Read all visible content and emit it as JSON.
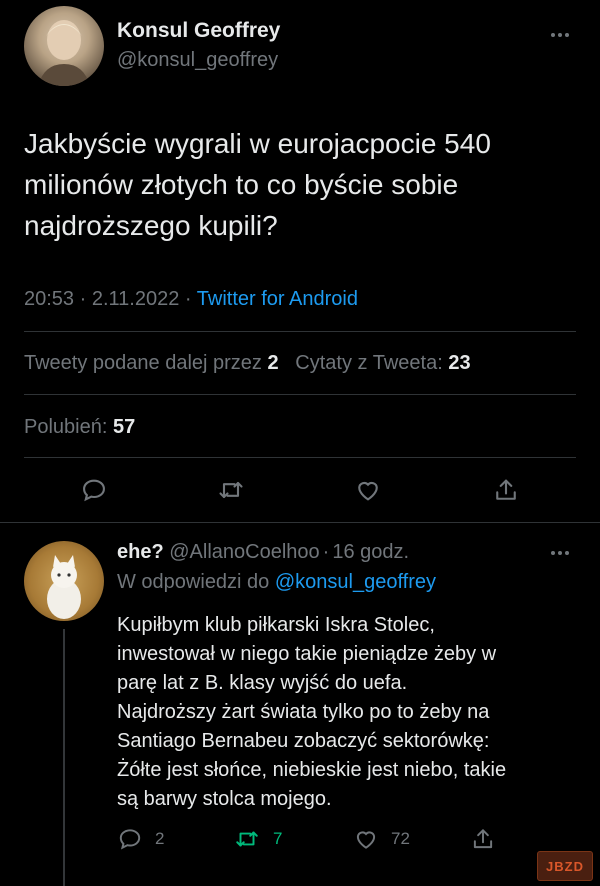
{
  "tweet": {
    "author_name": "Konsul Geoffrey",
    "author_handle": "@konsul_geoffrey",
    "text_lines": [
      "Jakbyście wygrali w eurojacpocie 540",
      "milionów złotych to co byście sobie",
      "najdroższego kupili?"
    ],
    "time": "20:53",
    "date": "2.11.2022",
    "sep": "·",
    "source": "Twitter for Android",
    "retweets_label": "Tweety podane dalej przez",
    "retweets_count": "2",
    "quotes_label": "Cytaty z Tweeta:",
    "quotes_count": "23",
    "likes_label": "Polubień:",
    "likes_count": "57"
  },
  "reply": {
    "author_name": "ehe?",
    "author_handle": "@AllanoCoelhoo",
    "sep": "·",
    "time_ago": "16 godz.",
    "replying_to_label": "W odpowiedzi do",
    "replying_to_handle": "@konsul_geoffrey",
    "text_lines": [
      "Kupiłbym klub piłkarski Iskra Stolec,",
      "inwestował w niego takie pieniądze żeby w",
      "parę lat z B. klasy wyjść do uefa.",
      "Najdroższy żart świata tylko po to żeby na",
      "Santiago Bernabeu zobaczyć sektorówkę:",
      "Żółte jest słońce, niebieskie jest niebo, takie",
      "są barwy stolca mojego."
    ],
    "replies_count": "2",
    "retweets_count": "7",
    "likes_count": "72"
  },
  "watermark": "JBZD",
  "colors": {
    "background": "#000000",
    "text": "#e7e9ea",
    "muted": "#71767b",
    "accent": "#1d9bf0",
    "retweet_green": "#00ba7c",
    "divider": "#2f3336"
  },
  "icons": [
    "more-icon",
    "reply-icon",
    "retweet-icon",
    "like-icon",
    "share-icon"
  ]
}
